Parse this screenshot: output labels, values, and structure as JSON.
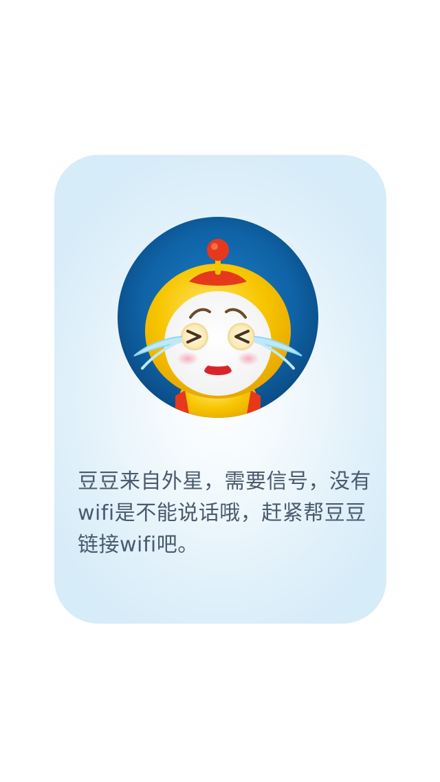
{
  "dialog": {
    "message": "豆豆来自外星，需要信号，没有wifi是不能说话哦，赶紧帮豆豆链接wifi吧。"
  },
  "mascot": {
    "name": "crying-robot-mascot-icon"
  },
  "colors": {
    "card_background": "#dcedf8",
    "message_text": "#4a5a6e",
    "avatar_background": "#0f62a5",
    "mascot_yellow": "#f7c600",
    "mascot_red": "#e6391c"
  }
}
